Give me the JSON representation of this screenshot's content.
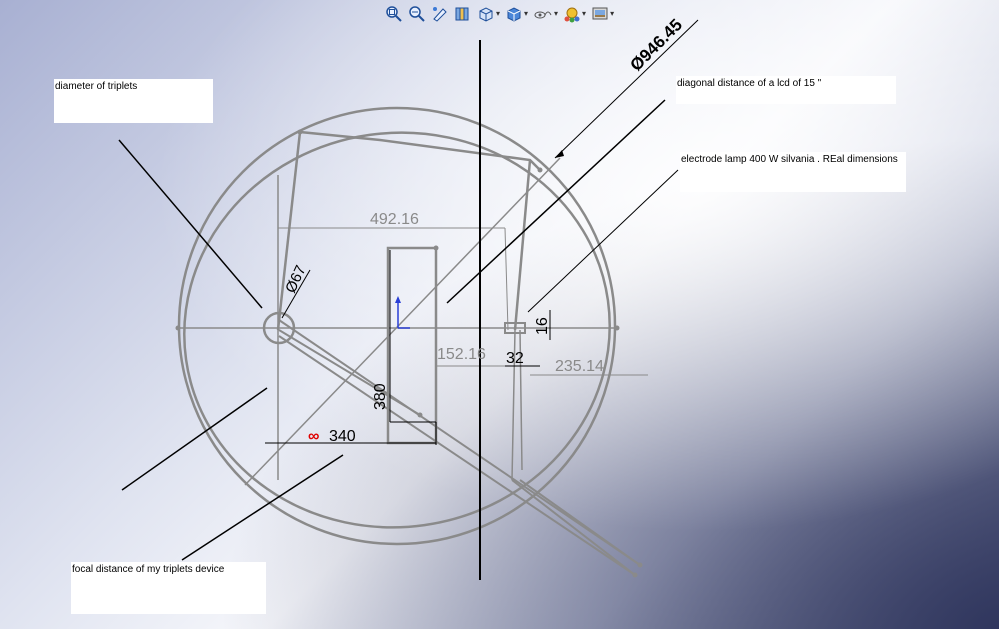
{
  "toolbar": {
    "buttons": [
      {
        "name": "zoom-to-fit-icon",
        "has_caret": false
      },
      {
        "name": "zoom-to-area-icon",
        "has_caret": false
      },
      {
        "name": "previous-view-icon",
        "has_caret": false
      },
      {
        "name": "section-view-icon",
        "has_caret": false
      },
      {
        "name": "view-orientation-icon",
        "has_caret": true
      },
      {
        "name": "display-style-icon",
        "has_caret": true
      },
      {
        "name": "hide-show-items-icon",
        "has_caret": true
      },
      {
        "name": "edit-appearance-icon",
        "has_caret": true
      },
      {
        "name": "apply-scene-icon",
        "has_caret": true
      }
    ]
  },
  "notes": {
    "triplets": "diameter of triplets",
    "lcd": "diagonal distance of a lcd of 15 \"",
    "lamp": "electrode lamp 400 W silvania . REal dimensions",
    "focal": "focal distance of my triplets device"
  },
  "dimensions": {
    "big_circle": "946.45",
    "width_492": "492.16",
    "triplet_dia": "67",
    "height_380": "380",
    "focal_340": "340",
    "offset_152": "152.16",
    "gap_32": "32",
    "radius_235": "235.14",
    "height_16": "16"
  },
  "symbols": {
    "diameter": "Ø",
    "infinity": "∞"
  },
  "colors": {
    "sketch_gray": "#8a8a8a",
    "dimension_dark": "#000000",
    "dimension_gray": "#8a8a8a",
    "origin_blue": "#2a3fd6",
    "infinity_red": "#e00000"
  }
}
